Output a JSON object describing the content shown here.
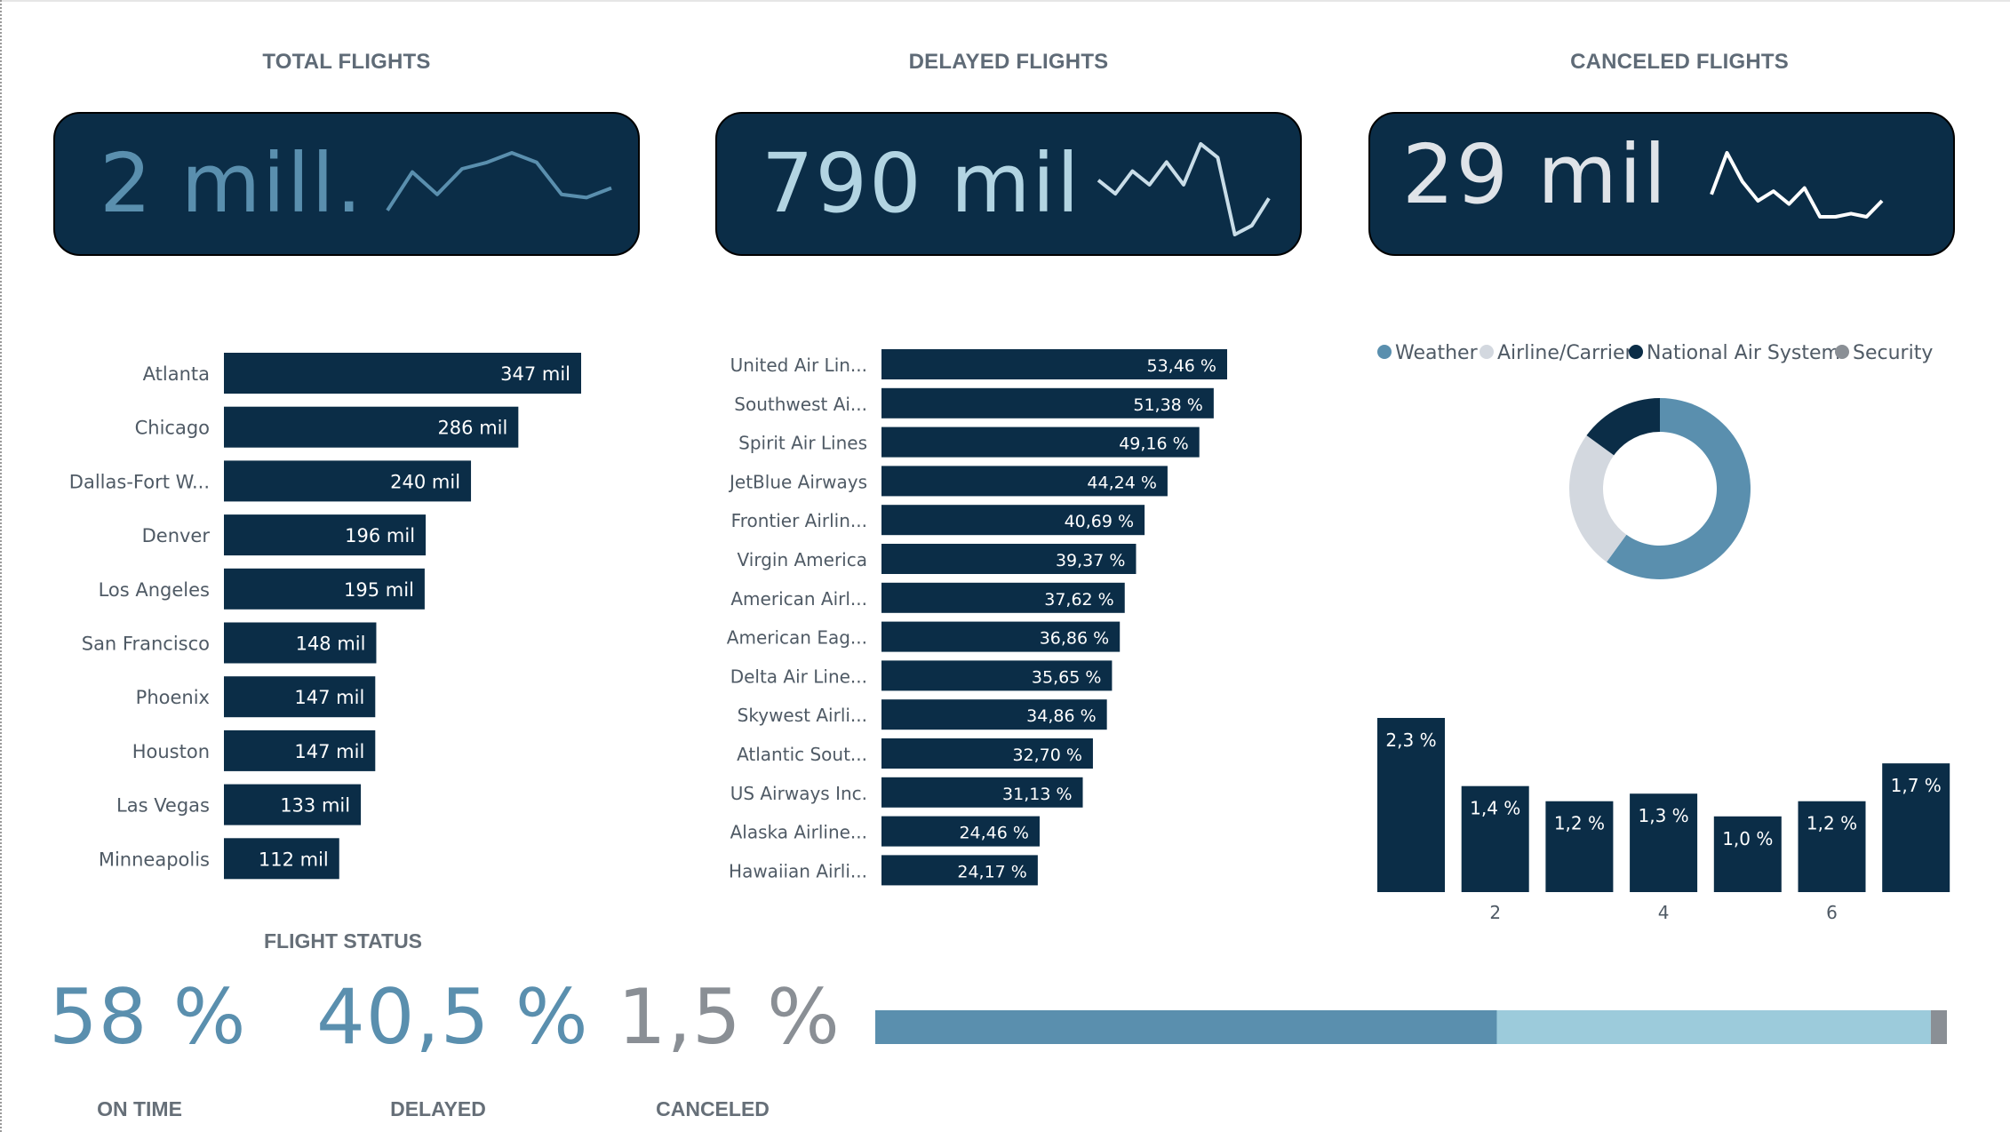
{
  "kpis": [
    {
      "title": "TOTAL FLIGHTS",
      "value": "2 mill.",
      "value_color": "#5a8fae",
      "spark_color": "#5a8fae",
      "spark": [
        0.1,
        0.7,
        0.35,
        0.75,
        0.85,
        1.0,
        0.85,
        0.35,
        0.3,
        0.45
      ]
    },
    {
      "title": "DELAYED FLIGHTS",
      "value": "790 mil",
      "value_color": "#b2d4e2",
      "spark_color": "#c9dde8",
      "spark": [
        0.6,
        0.45,
        0.7,
        0.55,
        0.8,
        0.55,
        1.0,
        0.85,
        0.0,
        0.1,
        0.4
      ]
    },
    {
      "title": "CANCELED FLIGHTS",
      "value": "29 mil",
      "value_color": "#dfe3e8",
      "spark_color": "#ffffff",
      "spark": [
        0.35,
        1.0,
        0.55,
        0.25,
        0.4,
        0.2,
        0.45,
        0.0,
        0.0,
        0.05,
        0.0,
        0.25
      ]
    }
  ],
  "flight_status": {
    "title": "FLIGHT STATUS",
    "items": [
      {
        "pct_label": "58 %",
        "label": "ON TIME",
        "value": 58,
        "color": "#5a8fae"
      },
      {
        "pct_label": "40,5 %",
        "label": "DELAYED",
        "value": 40.5,
        "color": "#9ccbdb"
      },
      {
        "pct_label": "1,5 %",
        "label": "CANCELED",
        "value": 1.5,
        "color": "#8a8f95"
      }
    ]
  },
  "chart_data": [
    {
      "type": "bar",
      "orientation": "horizontal",
      "categories": [
        "Atlanta",
        "Chicago",
        "Dallas-Fort W...",
        "Denver",
        "Los Angeles",
        "San Francisco",
        "Phoenix",
        "Houston",
        "Las Vegas",
        "Minneapolis"
      ],
      "values": [
        347,
        286,
        240,
        196,
        195,
        148,
        147,
        147,
        133,
        112
      ],
      "labels": [
        "347 mil",
        "286 mil",
        "240 mil",
        "196 mil",
        "195 mil",
        "148 mil",
        "147 mil",
        "147 mil",
        "133 mil",
        "112 mil"
      ],
      "bar_color": "#0b2d47"
    },
    {
      "type": "bar",
      "orientation": "horizontal",
      "categories": [
        "United Air Lin...",
        "Southwest Ai...",
        "Spirit Air Lines",
        "JetBlue Airways",
        "Frontier Airlin...",
        "Virgin America",
        "American Airl...",
        "American Eag...",
        "Delta Air Line...",
        "Skywest Airli...",
        "Atlantic Sout...",
        "US Airways Inc.",
        "Alaska Airline...",
        "Hawaiian Airli..."
      ],
      "values": [
        53.46,
        51.38,
        49.16,
        44.24,
        40.69,
        39.37,
        37.62,
        36.86,
        35.65,
        34.86,
        32.7,
        31.13,
        24.46,
        24.17
      ],
      "labels": [
        "53,46 %",
        "51,38 %",
        "49,16 %",
        "44,24 %",
        "40,69 %",
        "39,37 %",
        "37,62 %",
        "36,86 %",
        "35,65 %",
        "34,86 %",
        "32,70 %",
        "31,13 %",
        "24,46 %",
        "24,17 %"
      ],
      "bar_color": "#0b2d47"
    },
    {
      "type": "pie",
      "donut": true,
      "legend_position": "top",
      "series": [
        {
          "name": "Weather",
          "value": 0.6,
          "color": "#5a8fae"
        },
        {
          "name": "Airline/Carrier",
          "value": 0.25,
          "color": "#d3d8df"
        },
        {
          "name": "National Air System",
          "value": 0.15,
          "color": "#0b2d47"
        },
        {
          "name": "Security",
          "value": 0.0,
          "color": "#8a8f95"
        }
      ]
    },
    {
      "type": "bar",
      "orientation": "vertical",
      "x": [
        1,
        2,
        3,
        4,
        5,
        6,
        7
      ],
      "values": [
        2.3,
        1.4,
        1.2,
        1.3,
        1.0,
        1.2,
        1.7
      ],
      "labels": [
        "2,3 %",
        "1,4 %",
        "1,2 %",
        "1,3 %",
        "1,0 %",
        "1,2 %",
        "1,7 %"
      ],
      "x_tick_labels": [
        "2",
        "4",
        "6"
      ],
      "x_tick_values": [
        2,
        4,
        6
      ],
      "bar_color": "#0b2d47"
    }
  ]
}
